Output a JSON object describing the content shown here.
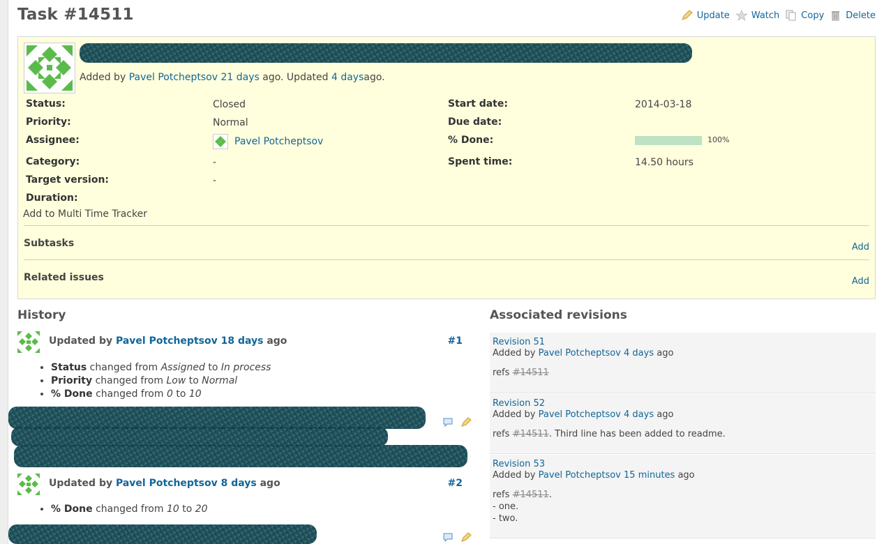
{
  "page": {
    "title": "Task #14511"
  },
  "contextual": {
    "update_label": "Update",
    "watch_label": "Watch",
    "copy_label": "Copy",
    "delete_label": "Delete",
    "icons": [
      "pencil-icon",
      "star-icon",
      "copy-icon",
      "trash-icon"
    ]
  },
  "issue": {
    "added_by_prefix": "Added by",
    "author": "Pavel Potcheptsov",
    "added_ago": "21 days",
    "ago1": "ago. Updated",
    "updated_ago": "4 days",
    "ago2": "ago.",
    "attributes": {
      "status_label": "Status:",
      "status_value": "Closed",
      "priority_label": "Priority:",
      "priority_value": "Normal",
      "assignee_label": "Assignee:",
      "assignee_value": "Pavel Potcheptsov",
      "category_label": "Category:",
      "category_value": "-",
      "target_version_label": "Target version:",
      "target_version_value": "-",
      "duration_label": "Duration:",
      "start_date_label": "Start date:",
      "start_date_value": "2014-03-18",
      "due_date_label": "Due date:",
      "done_label": "% Done:",
      "done_value": "100%",
      "done_fraction": 1.0,
      "spent_time_label": "Spent time:",
      "spent_time_value": "14.50 hours"
    },
    "multi_time_tracker_link": "Add to Multi Time Tracker",
    "subtasks_title": "Subtasks",
    "subtasks_add": "Add",
    "related_title": "Related issues",
    "related_add": "Add"
  },
  "history": {
    "title": "History",
    "journals": [
      {
        "updated_by": "Updated by",
        "author": "Pavel Potcheptsov",
        "when": "18 days",
        "ago": "ago",
        "number": "#1",
        "details": [
          {
            "field": "Status",
            "changed_from": "changed from",
            "from": "Assigned",
            "to_word": "to",
            "to": "In process"
          },
          {
            "field": "Priority",
            "changed_from": "changed from",
            "from": "Low",
            "to_word": "to",
            "to": "Normal"
          },
          {
            "field": "% Done",
            "changed_from": "changed from",
            "from": "0",
            "to_word": "to",
            "to": "10"
          }
        ]
      },
      {
        "updated_by": "Updated by",
        "author": "Pavel Potcheptsov",
        "when": "8 days",
        "ago": "ago",
        "number": "#2",
        "details": [
          {
            "field": "% Done",
            "changed_from": "changed from",
            "from": "10",
            "to_word": "to",
            "to": "20"
          }
        ]
      }
    ]
  },
  "revisions": {
    "title": "Associated revisions",
    "items": [
      {
        "name": "Revision 51",
        "added_by": "Added by",
        "author": "Pavel Potcheptsov",
        "when": "4 days",
        "ago": "ago",
        "refs": "refs",
        "issue": "#14511",
        "rest": "",
        "lines": []
      },
      {
        "name": "Revision 52",
        "added_by": "Added by",
        "author": "Pavel Potcheptsov",
        "when": "4 days",
        "ago": "ago",
        "refs": "refs",
        "issue": "#14511",
        "rest": ". Third line has been added to readme.",
        "lines": []
      },
      {
        "name": "Revision 53",
        "added_by": "Added by",
        "author": "Pavel Potcheptsov",
        "when": "15 minutes",
        "ago": "ago",
        "refs": "refs",
        "issue": "#14511",
        "rest": ".",
        "lines": [
          "- one.",
          "- two."
        ]
      }
    ]
  }
}
